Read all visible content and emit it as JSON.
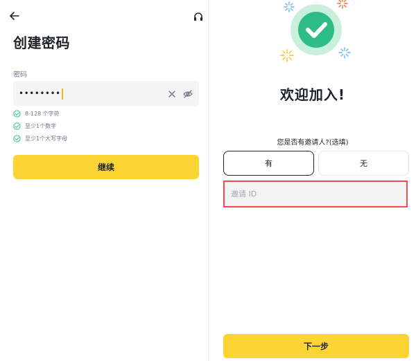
{
  "left_screen": {
    "title": "创建密码",
    "password_label": "密码",
    "password_value": "••••••••",
    "rules": [
      {
        "text": "8-128 个字符",
        "state": "satisfied"
      },
      {
        "text": "至少1个数字",
        "state": "satisfied"
      },
      {
        "text": "至少1个大写字母",
        "state": "satisfied"
      }
    ],
    "continue_label": "继续",
    "icons": {
      "back": "back-arrow-icon",
      "support": "headset-icon",
      "clear": "close-icon",
      "visibility": "eye-off-icon",
      "rule_check": "check-circle-icon"
    }
  },
  "right_screen": {
    "welcome_text": "欢迎加入!",
    "referral_question": "您是否有邀请人?(选填)",
    "options": {
      "yes_label": "有",
      "no_label": "无",
      "selected": "有"
    },
    "referral_input": {
      "placeholder": "邀请 ID",
      "value": ""
    },
    "next_label": "下一步",
    "icons": {
      "success": "check-badge-icon",
      "confetti": "sparkle-icon"
    }
  },
  "colors": {
    "brand_yellow": "#fcd535",
    "caret": "#f0b90b",
    "success_green": "#2ebd85",
    "success_ring": "#c8f0dc",
    "highlight_red": "#ea4d4d",
    "text_primary": "#1e2329",
    "text_secondary": "#707a8a",
    "confetti_blue": "#5cb8f0",
    "confetti_orange": "#f26a3c",
    "confetti_yellow": "#f5c21b"
  }
}
